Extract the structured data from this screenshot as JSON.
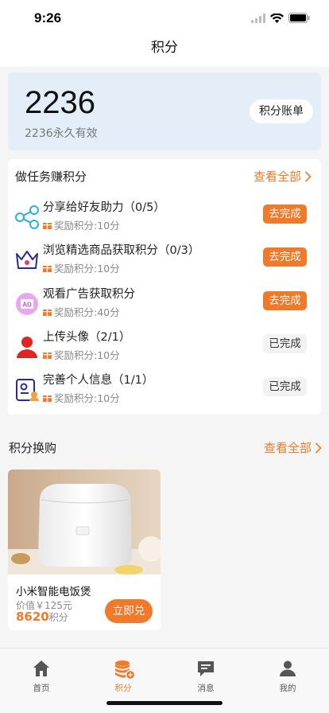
{
  "status_bar": {
    "time": "9:26"
  },
  "nav": {
    "title": "积分"
  },
  "points": {
    "value": "2236",
    "sub": "2236永久有效",
    "ledger_label": "积分账单"
  },
  "tasks": {
    "header": "做任务赚积分",
    "view_all": "查看全部",
    "items": [
      {
        "title": "分享给好友助力（0/5）",
        "reward": "奖励积分:10分",
        "button": "去完成",
        "icon": "share-icon",
        "done": false
      },
      {
        "title": "浏览精选商品获取积分（0/3）",
        "reward": "奖励积分:10分",
        "button": "去完成",
        "icon": "crown-icon",
        "done": false
      },
      {
        "title": "观看广告获取积分",
        "reward": "奖励积分:40分",
        "button": "去完成",
        "icon": "ad-icon",
        "done": false
      },
      {
        "title": "上传头像（2/1）",
        "reward": "奖励积分:10分",
        "button": "已完成",
        "icon": "user-icon",
        "done": true
      },
      {
        "title": "完善个人信息（1/1）",
        "reward": "奖励积分:10分",
        "button": "已完成",
        "icon": "profile-card-icon",
        "done": true
      }
    ]
  },
  "exchange": {
    "header": "积分换购",
    "view_all": "查看全部",
    "product": {
      "name": "小米智能电饭煲",
      "price": "价值￥125元",
      "points_value": "8620",
      "points_unit": "积分",
      "button": "立即兑"
    }
  },
  "tab_bar": {
    "items": [
      {
        "label": "首页",
        "icon": "home-icon",
        "active": false
      },
      {
        "label": "积分",
        "icon": "coins-icon",
        "active": true
      },
      {
        "label": "消息",
        "icon": "message-icon",
        "active": false
      },
      {
        "label": "我的",
        "icon": "user-icon",
        "active": false
      }
    ]
  },
  "colors": {
    "accent": "#f07a2a",
    "card_blue": "#e3eef9"
  }
}
